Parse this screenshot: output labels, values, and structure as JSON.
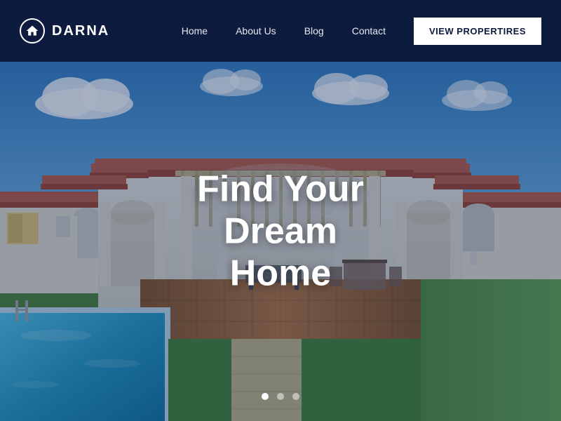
{
  "brand": {
    "name": "DARNA",
    "logo_alt": "darna-logo"
  },
  "navbar": {
    "links": [
      {
        "id": "home",
        "label": "Home",
        "href": "#"
      },
      {
        "id": "about",
        "label": "About Us",
        "href": "#"
      },
      {
        "id": "blog",
        "label": "Blog",
        "href": "#"
      },
      {
        "id": "contact",
        "label": "Contact",
        "href": "#"
      }
    ],
    "cta_label": "VIEW PROPERTIRES",
    "bg_color": "#0d1b3e"
  },
  "hero": {
    "title_line1": "Find Your Dream",
    "title_line2": "Home",
    "overlay_opacity": "0.35"
  },
  "slider": {
    "total": 3,
    "active": 0
  }
}
